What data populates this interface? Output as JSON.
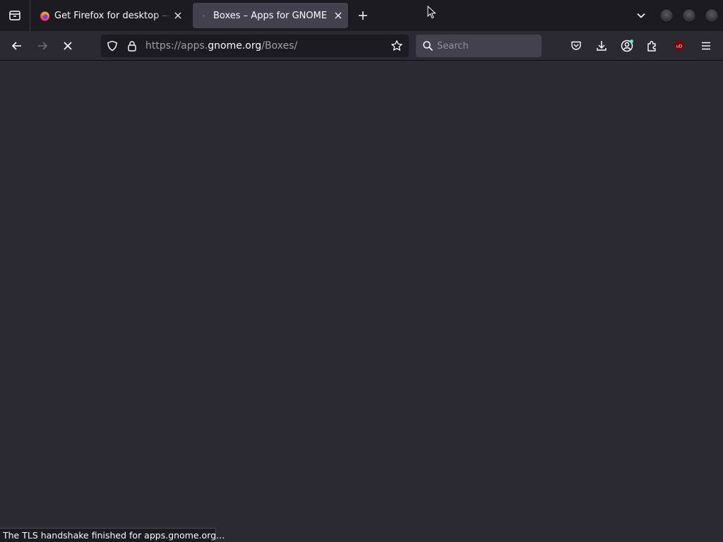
{
  "tabs": [
    {
      "title": "Get Firefox for desktop — Mozilla",
      "icon": "firefox-logo-icon",
      "active": false
    },
    {
      "title": "Boxes – Apps for GNOME",
      "icon": "loading-spinner-icon",
      "active": true
    }
  ],
  "urlbar": {
    "prefix": "https://apps.",
    "host": "gnome.org",
    "path": "/Boxes/"
  },
  "search": {
    "placeholder": "Search"
  },
  "status": "The TLS handshake finished for apps.gnome.org…",
  "colors": {
    "tabbar_bg": "#1c1b22",
    "toolbar_bg": "#2b2a33",
    "active_tab_bg": "#42414d",
    "content_bg": "#2b2a33",
    "text": "#fbfbfe",
    "ublock_red": "#800000"
  }
}
